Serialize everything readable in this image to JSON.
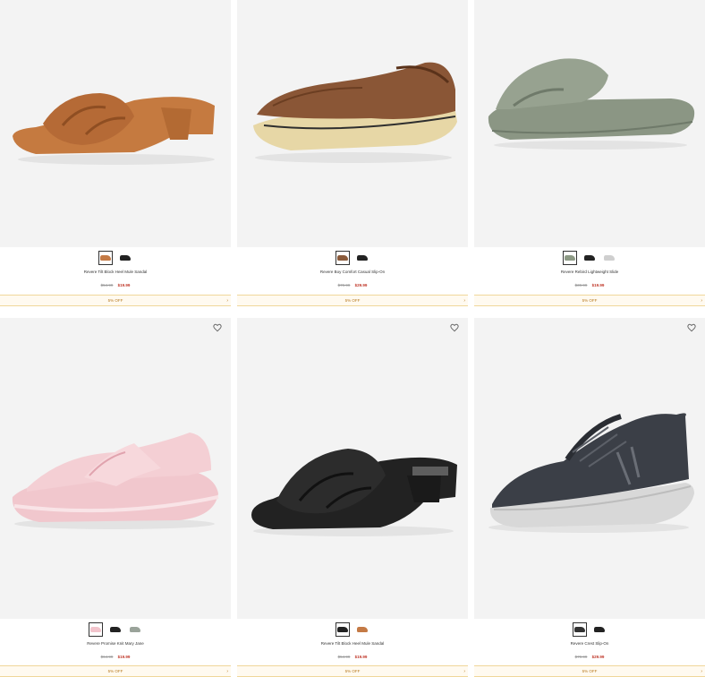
{
  "products": [
    {
      "name": "Revere Tilt Block Heel Mule Sandal",
      "old_price": "$54.99",
      "new_price": "$19.99",
      "promo": "5% OFF",
      "favorite_icon": false,
      "swatches": [
        "#c47a45",
        "#222222"
      ],
      "selected": 0
    },
    {
      "name": "Revere Boy Comfort Casual Slip-On",
      "old_price": "$79.99",
      "new_price": "$29.99",
      "promo": "5% OFF",
      "favorite_icon": false,
      "swatches": [
        "#8a5a3a",
        "#222222"
      ],
      "selected": 0
    },
    {
      "name": "Revere Rebird Lightweight Slide",
      "old_price": "$39.99",
      "new_price": "$19.99",
      "promo": "5% OFF",
      "favorite_icon": false,
      "swatches": [
        "#8d9a85",
        "#222222",
        "#cfcfcf"
      ],
      "selected": 0
    },
    {
      "name": "Revere Promise Knit Mary Jane",
      "old_price": "$64.99",
      "new_price": "$19.99",
      "promo": "5% OFF",
      "favorite_icon": true,
      "swatches": [
        "#f2c4cc",
        "#222222",
        "#9aa39a"
      ],
      "selected": 0
    },
    {
      "name": "Revere Tilt Block Heel Mule Sandal",
      "old_price": "$54.99",
      "new_price": "$19.99",
      "promo": "5% OFF",
      "favorite_icon": true,
      "swatches": [
        "#222222",
        "#c47a45"
      ],
      "selected": 0
    },
    {
      "name": "Revere Crest Slip-On",
      "old_price": "$79.99",
      "new_price": "$29.99",
      "promo": "5% OFF",
      "favorite_icon": true,
      "swatches": [
        "#333333",
        "#222222"
      ],
      "selected": 0
    }
  ],
  "colors": {
    "price": "#c0392b",
    "promo_text": "#b7791f",
    "promo_border": "#f0d79a",
    "image_bg": "#f3f3f3"
  }
}
